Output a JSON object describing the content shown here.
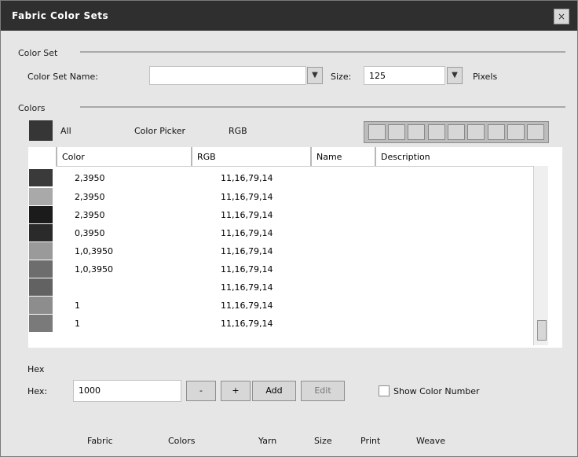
{
  "window": {
    "title": "Fabric Color Sets"
  },
  "top_section": {
    "group_label": "Color Set",
    "set_label": "Color Set Name:",
    "set_value": "",
    "size_label": "Size:",
    "size_value": "125",
    "size_unit": "Pixels"
  },
  "colors_section": {
    "group_label": "Colors",
    "swatch_label": "All",
    "pick_label": "Color Picker",
    "mode_label": "RGB"
  },
  "list": {
    "headers": [
      "Color",
      "RGB",
      "Name",
      "Description"
    ],
    "rows": [
      {
        "color": "#3a3a3a",
        "name": "2,3950",
        "rgb": "11,16,79,14"
      },
      {
        "color": "#a9a9a9",
        "name": "2,3950",
        "rgb": "11,16,79,14"
      },
      {
        "color": "#1b1b1b",
        "name": "2,3950",
        "rgb": "11,16,79,14"
      },
      {
        "color": "#2a2a2a",
        "name": "0,3950",
        "rgb": "11,16,79,14"
      },
      {
        "color": "#9a9a9a",
        "name": "1,0,3950",
        "rgb": "11,16,79,14"
      },
      {
        "color": "#6d6d6d",
        "name": "1,0,3950",
        "rgb": "11,16,79,14"
      },
      {
        "color": "#626262",
        "name": "",
        "rgb": "11,16,79,14"
      },
      {
        "color": "#8d8d8d",
        "name": "1",
        "rgb": "11,16,79,14"
      },
      {
        "color": "#7a7a7a",
        "name": "1",
        "rgb": "11,16,79,14"
      }
    ]
  },
  "bottom": {
    "label1": "Hex",
    "label2": "Hex:",
    "hex_value": "1000",
    "btn_add": "Add",
    "btn_edit": "Edit",
    "check_label": "Show Color Number"
  },
  "footer": {
    "items": [
      "Fabric",
      "Colors",
      "Yarn",
      "Size",
      "Print",
      "Weave"
    ]
  }
}
